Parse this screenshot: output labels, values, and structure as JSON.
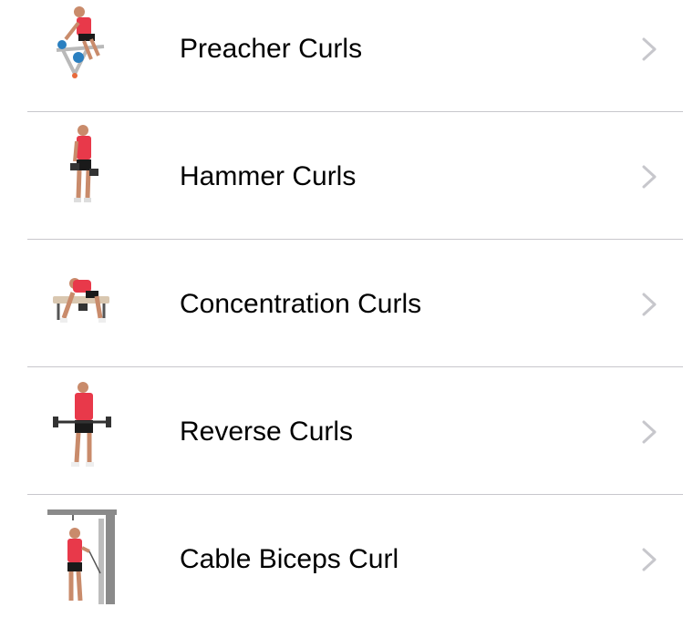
{
  "exercises": [
    {
      "label": "Preacher Curls",
      "thumbnail": "preacher-curl-illustration",
      "chevron": "chevron-right-icon"
    },
    {
      "label": "Hammer Curls",
      "thumbnail": "hammer-curl-illustration",
      "chevron": "chevron-right-icon"
    },
    {
      "label": "Concentration Curls",
      "thumbnail": "concentration-curl-illustration",
      "chevron": "chevron-right-icon"
    },
    {
      "label": "Reverse Curls",
      "thumbnail": "reverse-curl-illustration",
      "chevron": "chevron-right-icon"
    },
    {
      "label": "Cable Biceps Curl",
      "thumbnail": "cable-curl-illustration",
      "chevron": "chevron-right-icon"
    }
  ],
  "colors": {
    "shirt": "#e8394a",
    "skin": "#c98b6b",
    "shorts": "#1a1a1a",
    "separator": "#c8c7cc",
    "chevron": "#c7c7cc",
    "weight_blue": "#2a7fc0"
  }
}
